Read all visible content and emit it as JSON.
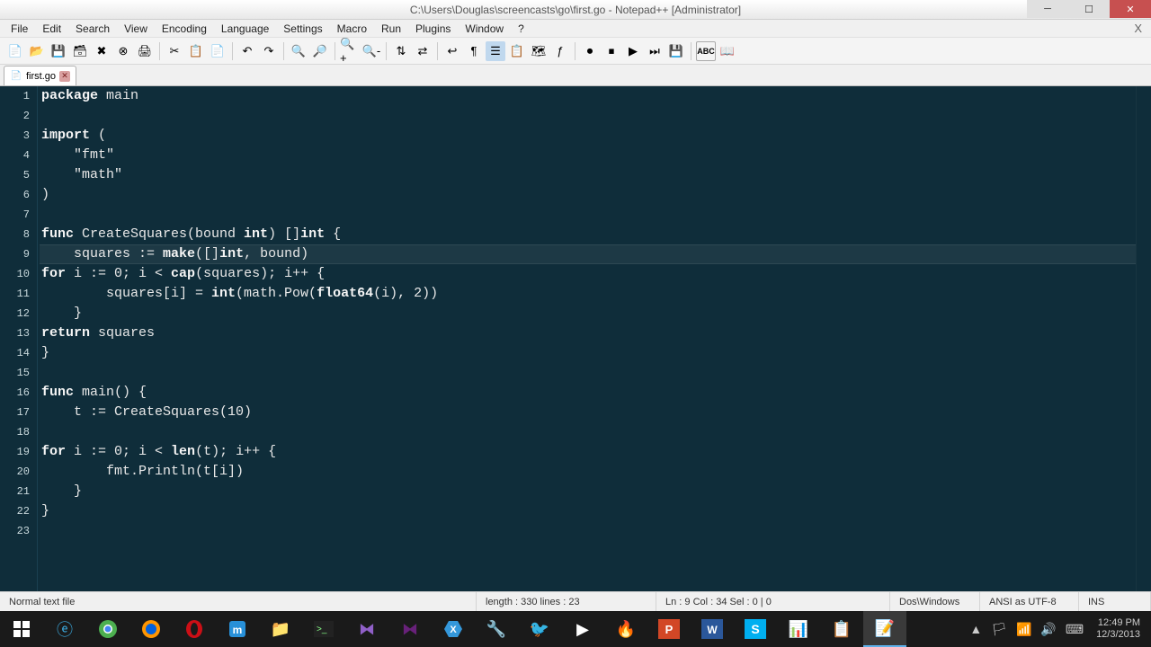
{
  "window": {
    "title": "C:\\Users\\Douglas\\screencasts\\go\\first.go - Notepad++ [Administrator]"
  },
  "menus": [
    "File",
    "Edit",
    "Search",
    "View",
    "Encoding",
    "Language",
    "Settings",
    "Macro",
    "Run",
    "Plugins",
    "Window",
    "?"
  ],
  "tab": {
    "name": "first.go"
  },
  "code": {
    "lines": [
      "package main",
      "",
      "import (",
      "    \"fmt\"",
      "    \"math\"",
      ")",
      "",
      "func CreateSquares(bound int) []int {",
      "    squares := make([]int, bound)",
      "    for i := 0; i < cap(squares); i++ {",
      "        squares[i] = int(math.Pow(float64(i), 2))",
      "    }",
      "    return squares",
      "}",
      "",
      "func main() {",
      "    t := CreateSquares(10)",
      "",
      "    for i := 0; i < len(t); i++ {",
      "        fmt.Println(t[i])",
      "    }",
      "}",
      ""
    ],
    "highlighted_line": 9
  },
  "status": {
    "filetype": "Normal text file",
    "length_label": "length : 330    lines : 23",
    "pos_label": "Ln : 9    Col : 34    Sel : 0 | 0",
    "os": "Dos\\Windows",
    "encoding": "ANSI as UTF-8",
    "mode": "INS"
  },
  "clock": {
    "time": "12:49 PM",
    "date": "12/3/2013"
  }
}
